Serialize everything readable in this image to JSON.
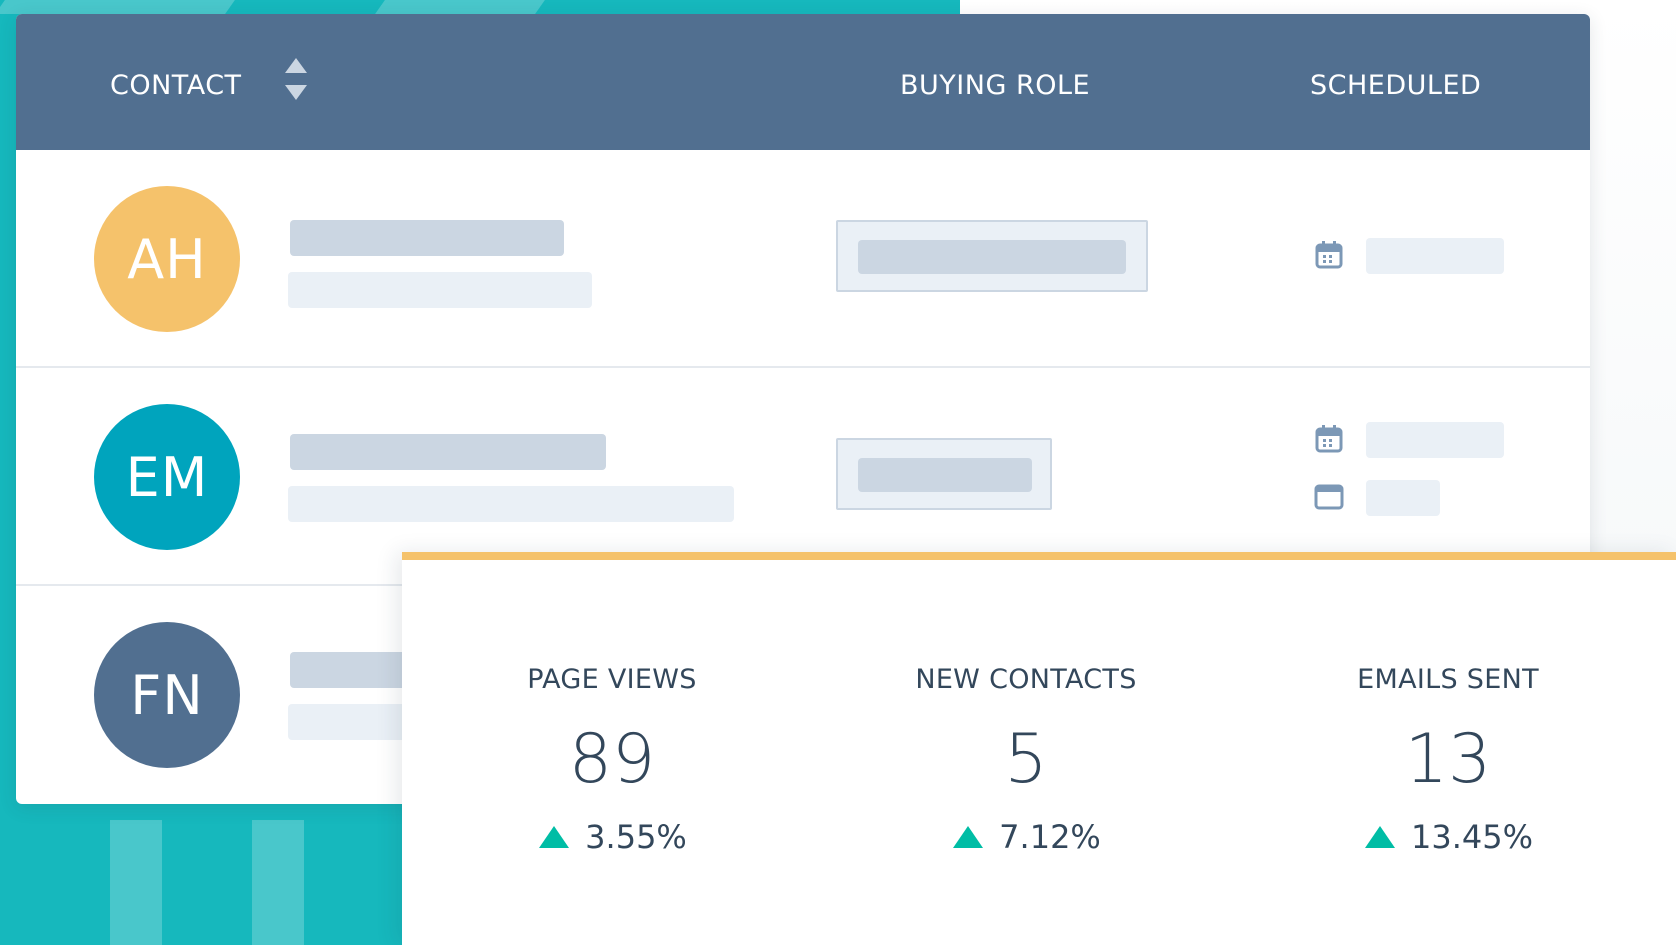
{
  "colors": {
    "header": "#516f90",
    "teal": "#16b8bd",
    "accent_orange": "#f5c26b",
    "up_green": "#00bda5",
    "text": "#33475b"
  },
  "table": {
    "columns": {
      "contact": "CONTACT",
      "buying_role": "BUYING ROLE",
      "scheduled": "SCHEDULED"
    },
    "rows": [
      {
        "initials": "AH",
        "avatar_color": "#f5c26b",
        "icons": [
          "calendar-icon"
        ]
      },
      {
        "initials": "EM",
        "avatar_color": "#00a4bd",
        "icons": [
          "calendar-icon",
          "email-icon"
        ]
      },
      {
        "initials": "FN",
        "avatar_color": "#516f90",
        "icons": []
      }
    ]
  },
  "stats": [
    {
      "title": "PAGE VIEWS",
      "value": "89",
      "change": "3.55%"
    },
    {
      "title": "NEW CONTACTS",
      "value": "5",
      "change": "7.12%"
    },
    {
      "title": "EMAILS SENT",
      "value": "13",
      "change": "13.45%"
    }
  ]
}
